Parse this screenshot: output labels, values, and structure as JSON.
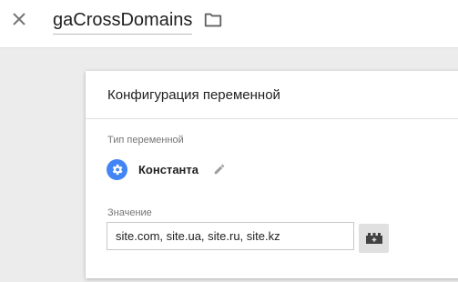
{
  "header": {
    "title": "gaCrossDomains",
    "close_icon": "close-icon",
    "folder_icon": "folder-icon"
  },
  "card": {
    "title": "Конфигурация переменной",
    "type_section": {
      "label": "Тип переменной",
      "type_name": "Константа",
      "type_icon": "gear-icon",
      "type_icon_color": "#4285f4",
      "edit_icon": "pencil-icon"
    },
    "value_section": {
      "label": "Значение",
      "value": "site.com, site.ua, site.ru, site.kz",
      "picker_icon": "variable-picker-icon"
    }
  }
}
